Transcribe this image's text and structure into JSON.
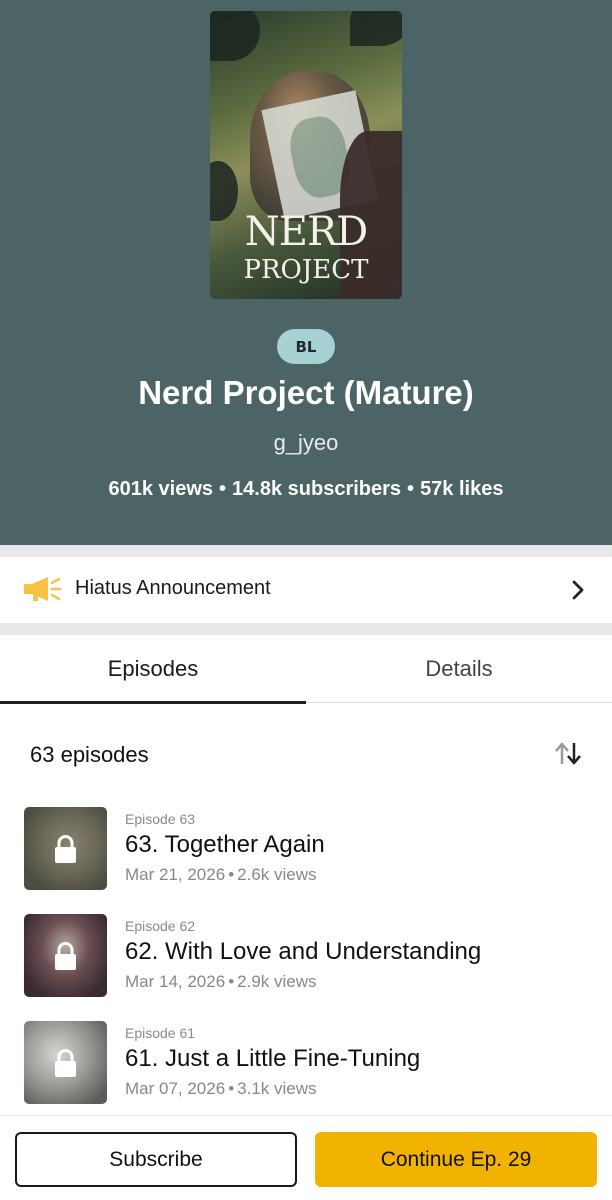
{
  "series": {
    "cover_title_line1": "NERD",
    "cover_title_line2": "PROJECT",
    "genre": "BL",
    "title": "Nerd Project (Mature)",
    "author": "g_jyeo",
    "stats": {
      "views": "601k views",
      "subscribers": "14.8k subscribers",
      "likes": "57k likes",
      "separator": "•"
    }
  },
  "announcement": {
    "icon": "megaphone-icon",
    "label": "Hiatus Announcement",
    "chevron": "chevron-right-icon"
  },
  "tabs": [
    {
      "label": "Episodes",
      "active": true
    },
    {
      "label": "Details",
      "active": false
    }
  ],
  "episodes_header": {
    "count_label": "63 episodes",
    "sort_icon": "sort-icon"
  },
  "episodes": [
    {
      "number_label": "Episode 63",
      "title": "63. Together Again",
      "date": "Mar 21, 2026",
      "views": "2.6k views",
      "locked": true
    },
    {
      "number_label": "Episode 62",
      "title": "62. With Love and Understanding",
      "date": "Mar 14, 2026",
      "views": "2.9k views",
      "locked": true
    },
    {
      "number_label": "Episode 61",
      "title": "61. Just a Little Fine-Tuning",
      "date": "Mar 07, 2026",
      "views": "3.1k views",
      "locked": true
    }
  ],
  "meta_separator": "•",
  "actions": {
    "subscribe_label": "Subscribe",
    "continue_label": "Continue Ep. 29"
  },
  "colors": {
    "hero_bg": "#4c6466",
    "genre_bg": "#a6d2d4",
    "continue_bg": "#f1b300",
    "announcement_icon": "#f6c243"
  }
}
